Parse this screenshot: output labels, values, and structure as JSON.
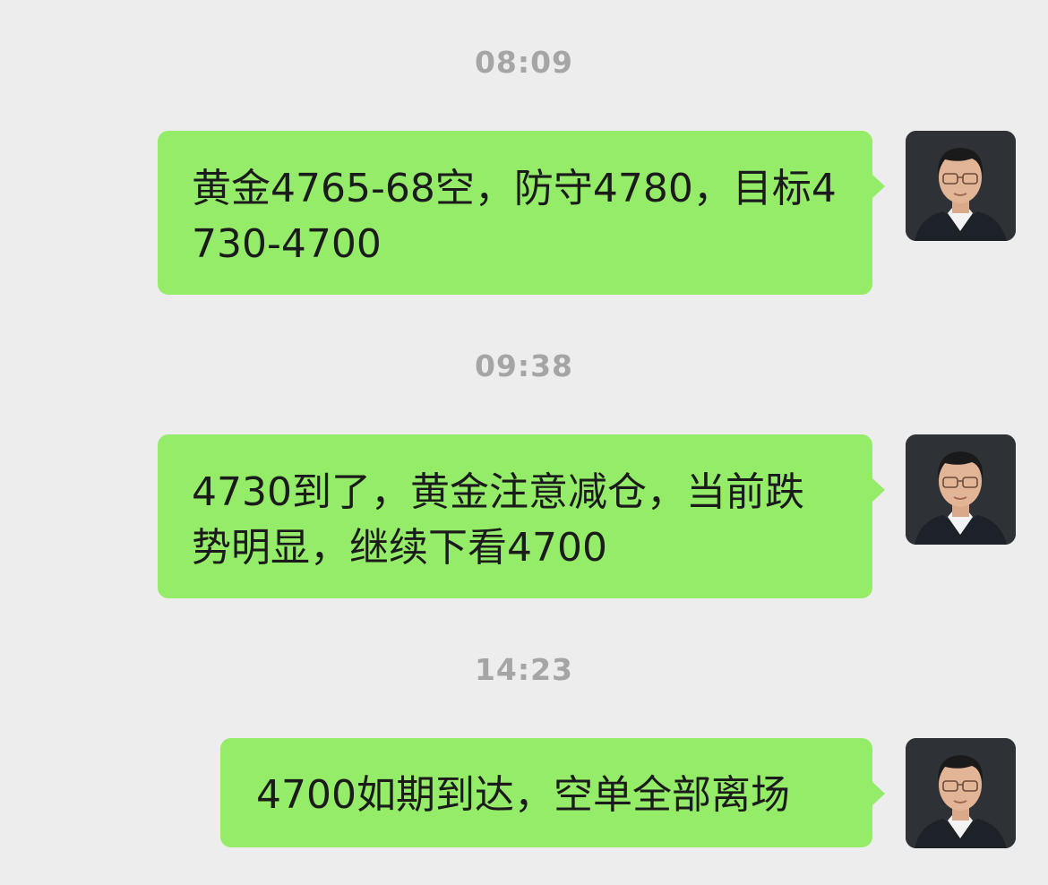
{
  "messages": [
    {
      "time": "08:09",
      "text": "黄金4765-68空，防守4780，目标4730-4700",
      "sender": "self",
      "avatar_icon": "man-with-glasses-portrait"
    },
    {
      "time": "09:38",
      "text": "4730到了，黄金注意减仓，当前跌势明显，继续下看4700",
      "sender": "self",
      "avatar_icon": "man-with-glasses-portrait"
    },
    {
      "time": "14:23",
      "text": "4700如期到达，空单全部离场",
      "sender": "self",
      "avatar_icon": "man-with-glasses-portrait"
    }
  ],
  "colors": {
    "background": "#ededed",
    "bubble": "#95ec69",
    "timestamp": "#a5a5a5",
    "text": "#1b1b1b"
  }
}
